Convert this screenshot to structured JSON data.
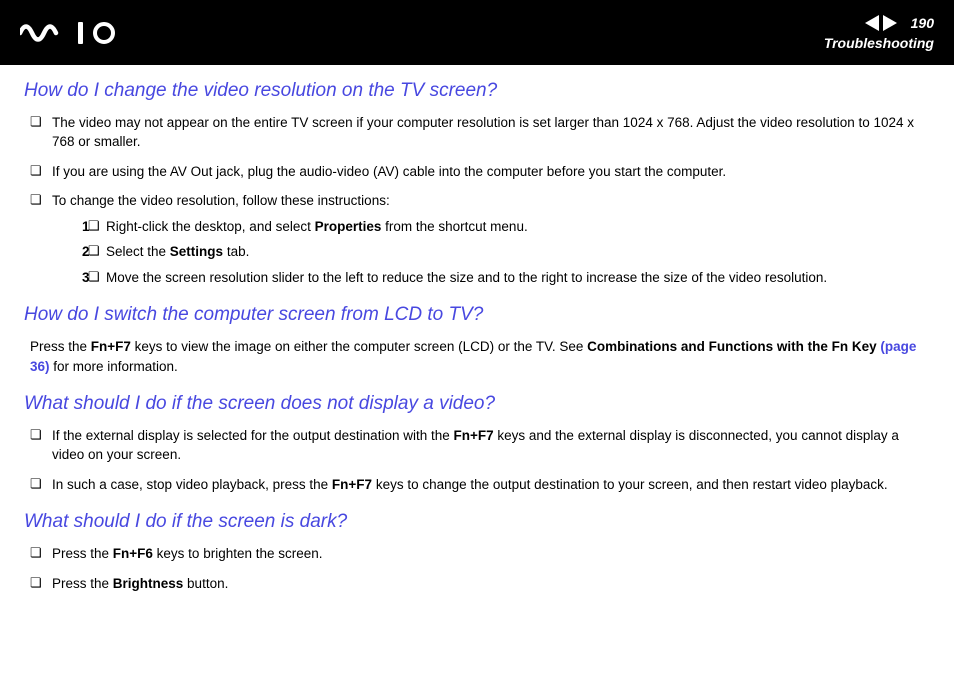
{
  "header": {
    "page_number": "190",
    "section": "Troubleshooting"
  },
  "q1": {
    "title": "How do I change the video resolution on the TV screen?",
    "b1a": "The video may not appear on the entire TV screen if your computer resolution is set larger than 1024 x 768. Adjust the video resolution to 1024 x 768 or smaller.",
    "b2a": "If you are using the AV Out jack, plug the audio-video (AV) cable into the computer before you start the computer.",
    "b3a": "To change the video resolution, follow these instructions:",
    "s1n": "1",
    "s1a": "Right-click the desktop, and select ",
    "s1b": "Properties",
    "s1c": " from the shortcut menu.",
    "s2n": "2",
    "s2a": "Select the ",
    "s2b": "Settings",
    "s2c": " tab.",
    "s3n": "3",
    "s3a": "Move the screen resolution slider to the left to reduce the size and to the right to increase the size of the video resolution."
  },
  "q2": {
    "title": "How do I switch the computer screen from LCD to TV?",
    "p1a": "Press the ",
    "p1b": "Fn+F7",
    "p1c": " keys to view the image on either the computer screen (LCD) or the TV. See ",
    "p1d": "Combinations and Functions with the Fn Key ",
    "p1link": "(page 36)",
    "p1e": " for more information."
  },
  "q3": {
    "title": "What should I do if the screen does not display a video?",
    "b1a": "If the external display is selected for the output destination with the ",
    "b1b": "Fn+F7",
    "b1c": " keys and the external display is disconnected, you cannot display a video on your screen.",
    "b2a": "In such a case, stop video playback, press the ",
    "b2b": "Fn+F7",
    "b2c": " keys to change the output destination to your screen, and then restart video playback."
  },
  "q4": {
    "title": "What should I do if the screen is dark?",
    "b1a": "Press the ",
    "b1b": "Fn+F6",
    "b1c": " keys to brighten the screen.",
    "b2a": "Press the ",
    "b2b": "Brightness",
    "b2c": " button."
  }
}
